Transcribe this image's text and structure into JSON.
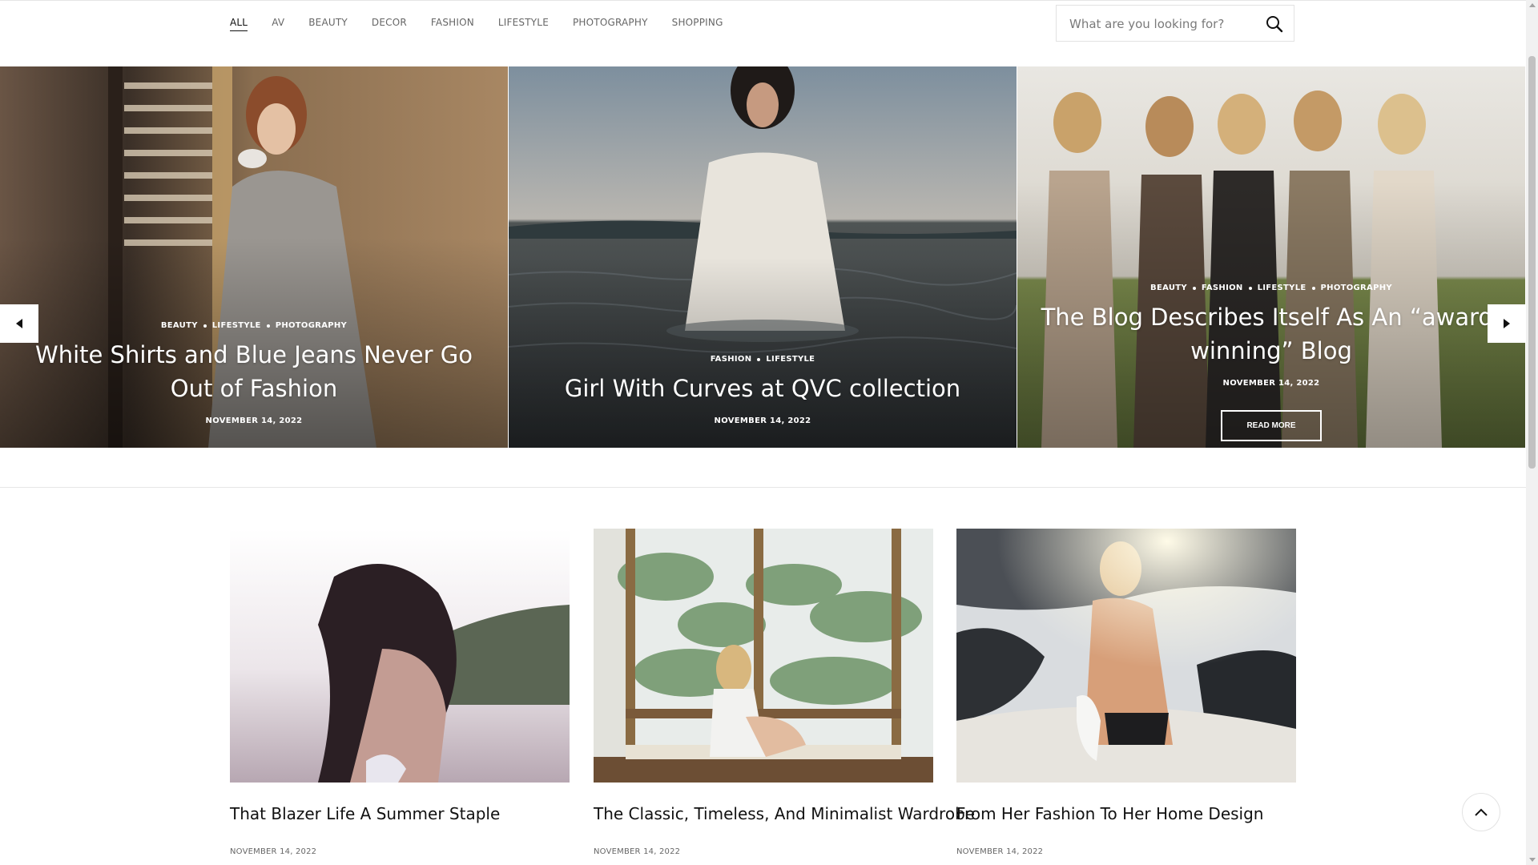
{
  "nav": {
    "items": [
      {
        "label": "ALL",
        "active": true
      },
      {
        "label": "AV"
      },
      {
        "label": "BEAUTY"
      },
      {
        "label": "DECOR"
      },
      {
        "label": "FASHION"
      },
      {
        "label": "LIFESTYLE"
      },
      {
        "label": "PHOTOGRAPHY"
      },
      {
        "label": "SHOPPING"
      }
    ]
  },
  "search": {
    "placeholder": "What are you looking for?",
    "icon": "search-icon"
  },
  "slider": {
    "prev_icon": "chevron-left-icon",
    "next_icon": "chevron-right-icon",
    "slides": [
      {
        "categories": [
          "BEAUTY",
          "LIFESTYLE",
          "PHOTOGRAPHY"
        ],
        "title": "White Shirts and Blue Jeans Never Go Out of Fashion",
        "date": "NOVEMBER 14, 2022"
      },
      {
        "categories": [
          "FASHION",
          "LIFESTYLE"
        ],
        "title": "Girl With Curves at QVC collection",
        "date": "NOVEMBER 14, 2022"
      },
      {
        "categories": [
          "BEAUTY",
          "FASHION",
          "LIFESTYLE",
          "PHOTOGRAPHY"
        ],
        "title": "The Blog Describes Itself As An “award-winning” Blog",
        "date": "NOVEMBER 14, 2022",
        "button": "READ MORE"
      }
    ]
  },
  "posts": [
    {
      "title": "That Blazer Life A Summer Staple",
      "date": "NOVEMBER 14, 2022"
    },
    {
      "title": "The Classic, Timeless, And Minimalist Wardrobe",
      "date": "NOVEMBER 14, 2022"
    },
    {
      "title": "From Her Fashion To Her Home Design",
      "date": "NOVEMBER 14, 2022"
    }
  ],
  "back_to_top": {
    "icon": "chevron-up-icon"
  },
  "colors": {
    "text": "#111111",
    "muted": "#666666",
    "border": "#e2e2e2",
    "overlay_text": "#ffffff"
  }
}
